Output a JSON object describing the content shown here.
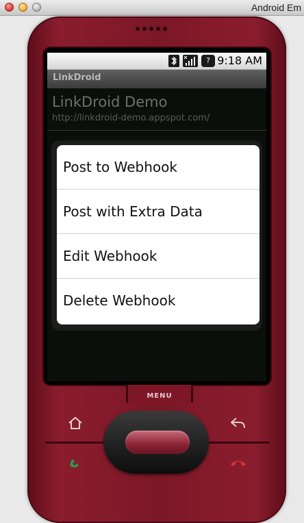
{
  "window": {
    "title": "Android Em"
  },
  "status_bar": {
    "time": "9:18 AM",
    "icons": [
      "bluetooth-icon",
      "signal-icon",
      "help-icon"
    ]
  },
  "app": {
    "title": "LinkDroid"
  },
  "list_item": {
    "title": "LinkDroid Demo",
    "url": "http://linkdroid-demo.appspot.com/"
  },
  "context_menu": {
    "items": [
      "Post to Webhook",
      "Post with Extra Data",
      "Edit Webhook",
      "Delete Webhook"
    ]
  },
  "hardware": {
    "menu_label": "MENU"
  },
  "colors": {
    "phone_body": "#7b1727",
    "trackball": "#8a2335",
    "call_icon": "#2e9a55",
    "end_icon": "#d8343a"
  }
}
